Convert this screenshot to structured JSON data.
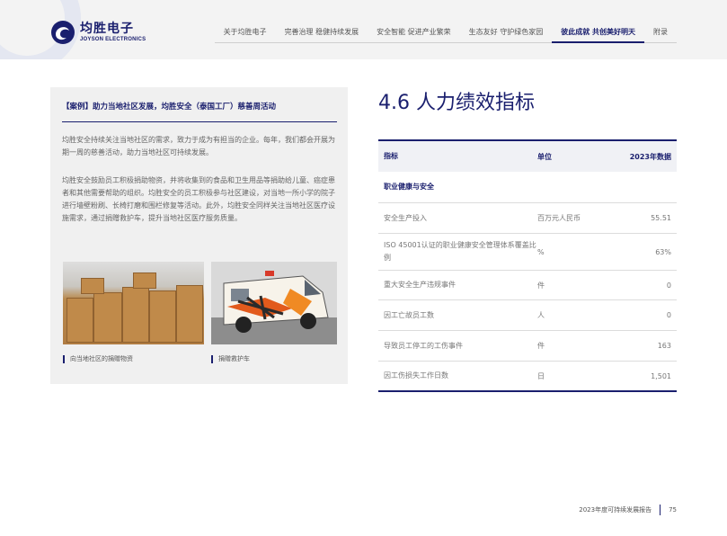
{
  "header": {
    "logo_cn": "均胜电子",
    "logo_en": "JOYSON ELECTRONICS",
    "nav": [
      {
        "label": "关于均胜电子",
        "active": false
      },
      {
        "label": "完善治理 稳健持续发展",
        "active": false
      },
      {
        "label": "安全智能 促进产业繁荣",
        "active": false
      },
      {
        "label": "生态友好 守护绿色家园",
        "active": false
      },
      {
        "label": "彼此成就 共创美好明天",
        "active": true
      },
      {
        "label": "附录",
        "active": false
      }
    ]
  },
  "case": {
    "title": "【案例】助力当地社区发展，均胜安全（泰国工厂）慈善周活动",
    "p1": "均胜安全持续关注当地社区的需求，致力于成为有担当的企业。每年，我们都会开展为期一周的慈善活动，助力当地社区可持续发展。",
    "p2": "均胜安全鼓励员工积极捐助物资，并将收集到的食品和卫生用品等捐助给儿童、癌症患者和其他需要帮助的组织。均胜安全的员工积极参与社区建设，对当地一所小学的院子进行墙壁粉刷、长椅打磨和围栏修复等活动。此外，均胜安全同样关注当地社区医疗设施需求，通过捐赠救护车，提升当地社区医疗服务质量。",
    "caption1": "向当地社区的捐赠物资",
    "caption2": "捐赠救护车"
  },
  "section": {
    "title": "4.6 人力绩效指标"
  },
  "table": {
    "headers": [
      "指标",
      "单位",
      "2023年数据"
    ],
    "category": "职业健康与安全",
    "rows": [
      {
        "indicator": "安全生产投入",
        "unit": "百万元人民币",
        "value": "55.51"
      },
      {
        "indicator": "ISO 45001认证的职业健康安全管理体系覆盖比例",
        "unit": "%",
        "value": "63%"
      },
      {
        "indicator": "重大安全生产违规事件",
        "unit": "件",
        "value": "0"
      },
      {
        "indicator": "因工亡故员工数",
        "unit": "人",
        "value": "0"
      },
      {
        "indicator": "导致员工停工的工伤事件",
        "unit": "件",
        "value": "163"
      },
      {
        "indicator": "因工伤损失工作日数",
        "unit": "日",
        "value": "1,501"
      }
    ]
  },
  "footer": {
    "report": "2023年度可持续发展报告",
    "page": "75"
  },
  "colors": {
    "brand": "#1a1f6e",
    "panel": "#f0f0f0"
  }
}
